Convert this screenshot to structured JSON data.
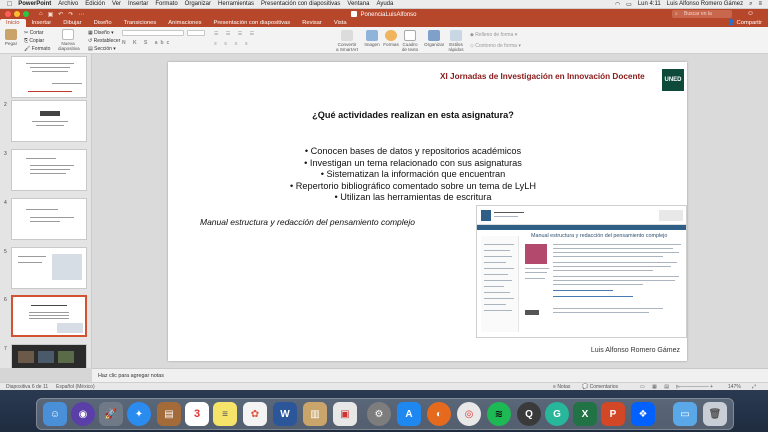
{
  "menubar": {
    "app": "PowerPoint",
    "items": [
      "Archivo",
      "Edición",
      "Ver",
      "Insertar",
      "Formato",
      "Organizar",
      "Herramientas",
      "Presentación con diapositivas",
      "Ventana",
      "Ayuda"
    ],
    "clock": "Lun 4:11",
    "user": "Luis Alfonso Romero Gámez"
  },
  "titlebar": {
    "doc_title": "PonenciaLuisAlfonso",
    "search_placeholder": "Buscar en la presentación"
  },
  "ribbon": {
    "tabs": [
      "Inicio",
      "Insertar",
      "Dibujar",
      "Diseño",
      "Transiciones",
      "Animaciones",
      "Presentación con diapositivas",
      "Revisar",
      "Vista"
    ],
    "active_tab": "Inicio",
    "share": "Compartir",
    "paste": "Pegar",
    "cut": "Cortar",
    "copy": "Copiar",
    "format": "Formato",
    "new_slide": "Nueva diapositiva",
    "layout": "Diseño",
    "reset": "Restablecer",
    "section": "Sección",
    "convert_smartart": "Convertir a SmartArt",
    "image": "Imagen",
    "shapes": "Formas",
    "textbox": "Cuadro de texto",
    "arrange": "Organizar",
    "quick_styles": "Estilos rápidos",
    "shape_fill": "Relleno de forma",
    "shape_outline": "Contorno de forma"
  },
  "thumbnails": [
    {
      "num": ""
    },
    {
      "num": "2"
    },
    {
      "num": "3"
    },
    {
      "num": "4"
    },
    {
      "num": "5"
    },
    {
      "num": "6"
    },
    {
      "num": "7"
    }
  ],
  "slide": {
    "header": "XI Jornadas de Investigación en Innovación Docente",
    "logo": "UNED",
    "question": "¿Qué actividades realizan en esta asignatura?",
    "bullets": [
      "•   Conocen bases de datos y repositorios académicos",
      "•   Investigan un tema relacionado con sus asignaturas",
      "•   Sistematizan la información que encuentran",
      "•   Repertorio bibliográfico comentado sobre un tema de LyLH",
      "•   Utilizan las herramientas de escritura"
    ],
    "caption": "Manual estructura y redacción del pensamiento complejo",
    "author": "Luis Alfonso Romero Gámez",
    "embedded": {
      "title": "Manual estructura y redacción del pensamiento complejo"
    }
  },
  "notes": {
    "placeholder": "Haz clic para agregar notas"
  },
  "statusbar": {
    "slide_info": "Diapositiva 6 de 11",
    "language": "Español (México)",
    "notes_btn": "Notas",
    "comments_btn": "Comentarios",
    "zoom": "147%"
  },
  "colors": {
    "brand": "#b7472a",
    "selection": "#d35230",
    "uned": "#0e4a3a"
  }
}
